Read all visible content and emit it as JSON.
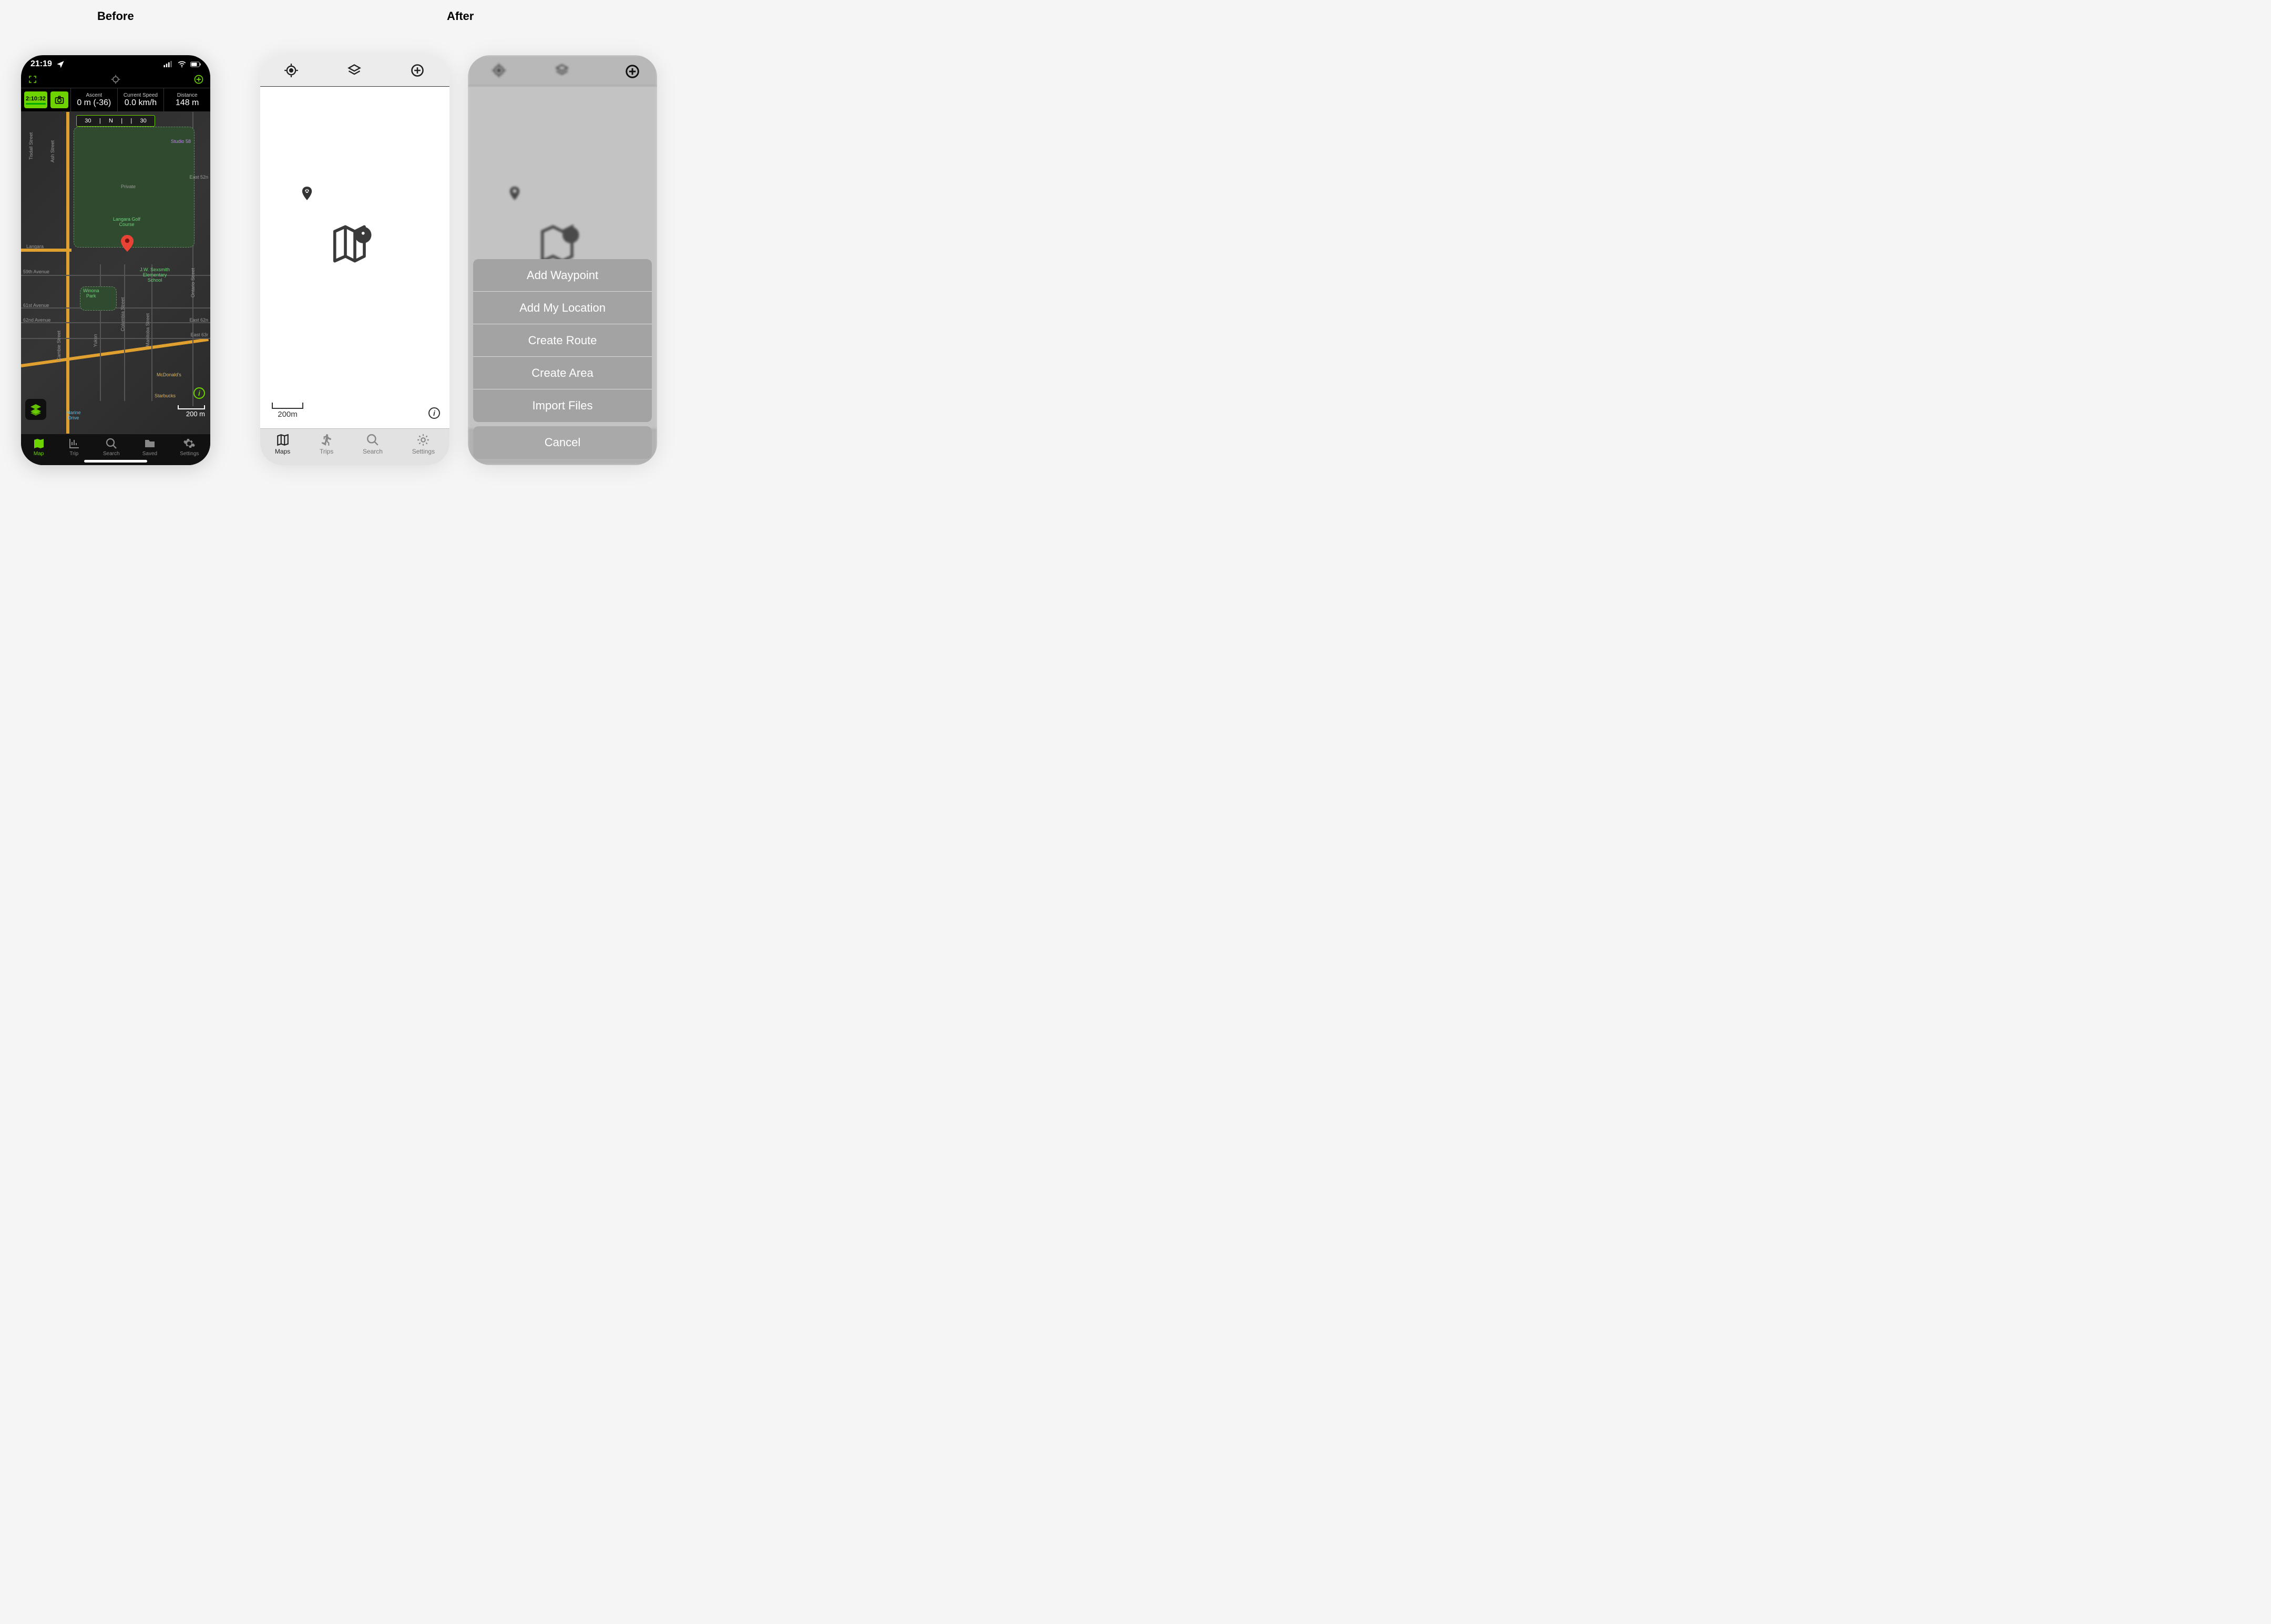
{
  "section_titles": {
    "before": "Before",
    "after": "After"
  },
  "before": {
    "status": {
      "time": "21:19"
    },
    "timer_chip": "2:10:32",
    "stats": [
      {
        "label": "Ascent",
        "value": "0 m (-36)"
      },
      {
        "label": "Current Speed",
        "value": "0.0 km/h"
      },
      {
        "label": "Distance",
        "value": "148 m"
      }
    ],
    "compass": {
      "left": "30",
      "center": "N",
      "right": "30"
    },
    "map_labels": {
      "ash_street": "Ash Street",
      "tisdall_street": "Tisdall Street",
      "east52": "East 52n",
      "studio58": "Studio 58",
      "private": "Private",
      "langara_golf": "Langara Golf\nCourse",
      "langara": "Langara",
      "avenue59": "59th Avenue",
      "winona": "Winona\nPark",
      "avenue61": "61st Avenue",
      "avenue62": "62nd Avenue",
      "east62": "East 62n",
      "east63": "East 63r",
      "jw_sesmith": "J.W. Sexsmith\nElementary\nSchool",
      "columbia": "Columbia Street",
      "manitoba": "Manitoba Street",
      "yukon": "Yukon",
      "cambie": "Cambie Street",
      "ontario": "Ontario Street",
      "mcdonalds": "McDonald's",
      "starbucks": "Starbucks",
      "marine": "Marine\nDrive"
    },
    "scale_text": "200 m",
    "tabs": [
      {
        "key": "map",
        "label": "Map",
        "active": true
      },
      {
        "key": "trip",
        "label": "Trip",
        "active": false
      },
      {
        "key": "search",
        "label": "Search",
        "active": false
      },
      {
        "key": "saved",
        "label": "Saved",
        "active": false
      },
      {
        "key": "settings",
        "label": "Settings",
        "active": false
      }
    ]
  },
  "after1": {
    "scale_text": "200m",
    "tabs": [
      {
        "key": "maps",
        "label": "Maps",
        "active": true
      },
      {
        "key": "trips",
        "label": "Trips",
        "active": false
      },
      {
        "key": "search",
        "label": "Search",
        "active": false
      },
      {
        "key": "settings",
        "label": "Settings",
        "active": false
      }
    ]
  },
  "after2": {
    "action_sheet": {
      "items": [
        "Add Waypoint",
        "Add My Location",
        "Create Route",
        "Create Area",
        "Import Files"
      ],
      "cancel": "Cancel"
    }
  }
}
